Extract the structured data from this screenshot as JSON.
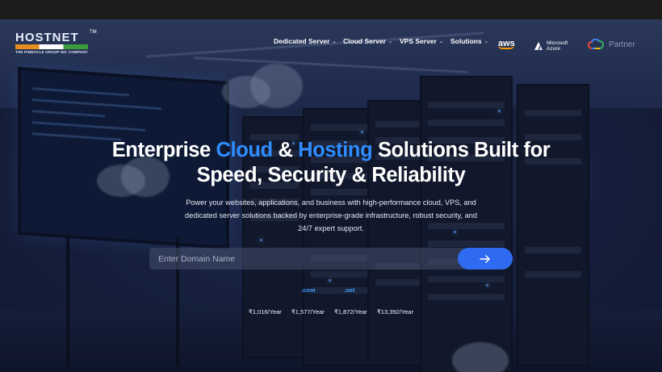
{
  "brand": {
    "name": "HOSTNET",
    "trademark": "TM",
    "tagline": "THE PINNACLE GROUP INC COMPANY",
    "colors": {
      "orange": "#e78c1e",
      "green": "#3c9c3c"
    }
  },
  "nav": {
    "items": [
      {
        "label": "Dedicated Server",
        "icon": "chevron-down-icon"
      },
      {
        "label": "Cloud Server",
        "icon": "chevron-down-icon"
      },
      {
        "label": "VPS Server",
        "icon": "chevron-down-icon"
      },
      {
        "label": "Solutions",
        "icon": "chevron-down-icon"
      }
    ]
  },
  "partners": {
    "aws": "aws",
    "azure_line1": "Microsoft",
    "azure_line2": "Azure",
    "google": "Partner"
  },
  "hero": {
    "headline_part1": "Enterprise",
    "headline_cloud": "Cloud",
    "headline_amp": "&",
    "headline_hosting": "Hosting",
    "headline_part2": "Solutions Built for",
    "headline_line2": "Speed, Security & Reliability",
    "subline": "Power your websites, applications, and business with high-performance cloud, VPS, and dedicated server solutions backed by enterprise-grade infrastructure, robust security, and 24/7 expert support.",
    "accent_color": "#2f8cff"
  },
  "search": {
    "placeholder": "Enter Domain Name",
    "button_icon": "arrow-right-icon"
  },
  "tlds": [
    {
      "label": ".com",
      "color": "#3d9cff"
    },
    {
      "label": ".net",
      "color": "#3d9cff"
    }
  ],
  "prices": [
    "₹1,016/Year",
    "₹1,577/Year",
    "₹1,872/Year",
    "₹13,392/Year"
  ]
}
